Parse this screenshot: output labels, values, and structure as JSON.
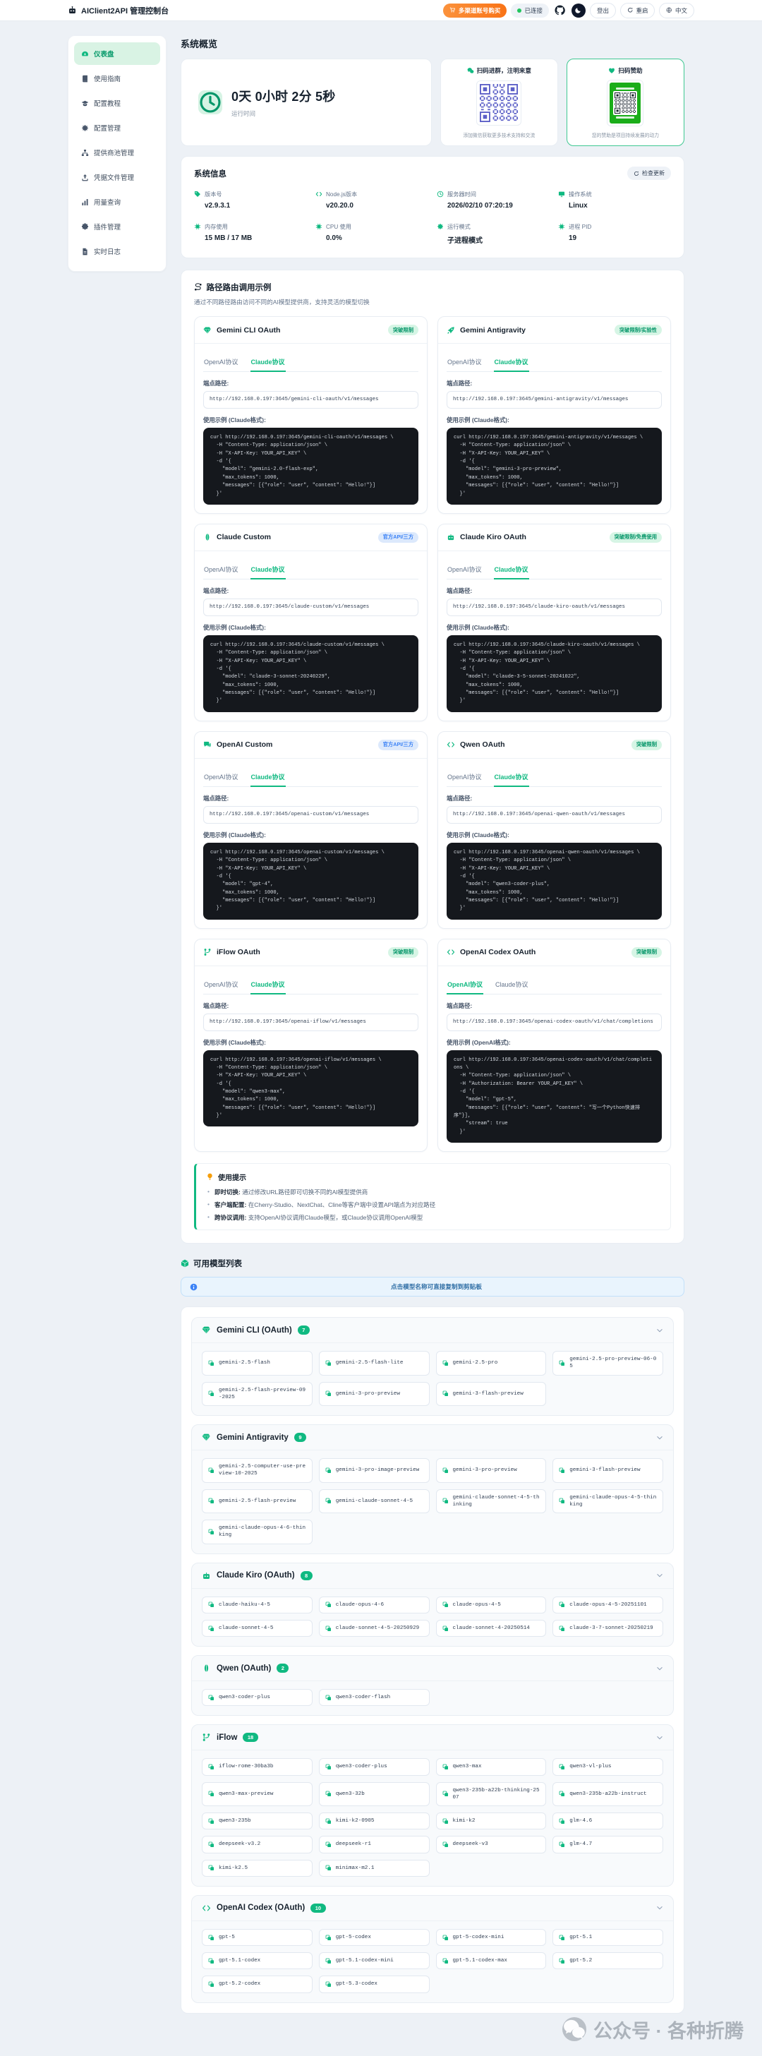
{
  "header": {
    "title": "AIClient2API 管理控制台",
    "logo_icon": "robot-icon",
    "buy_label": "多渠道账号购买",
    "buy_icon": "cart-icon",
    "status_label": "已连接",
    "github_icon": "github-icon",
    "theme_icon": "moon-icon",
    "logout_label": "登出",
    "restart_label": "重启",
    "restart_icon": "refresh-icon",
    "lang_label": "中文",
    "lang_icon": "globe-icon"
  },
  "sidebar": {
    "items": [
      {
        "id": "dashboard",
        "label": "仪表盘",
        "icon": "gauge",
        "active": true
      },
      {
        "id": "guide",
        "label": "使用指南",
        "icon": "book",
        "active": false
      },
      {
        "id": "tutorial",
        "label": "配置教程",
        "icon": "cap",
        "active": false
      },
      {
        "id": "config",
        "label": "配置管理",
        "icon": "gear",
        "active": false
      },
      {
        "id": "provider-pool",
        "label": "提供商池管理",
        "icon": "network",
        "active": false
      },
      {
        "id": "credentials",
        "label": "凭据文件管理",
        "icon": "upload",
        "active": false
      },
      {
        "id": "usage",
        "label": "用量查询",
        "icon": "chart",
        "active": false
      },
      {
        "id": "plugins",
        "label": "插件管理",
        "icon": "puzzle",
        "active": false
      },
      {
        "id": "logs",
        "label": "实时日志",
        "icon": "doc",
        "active": false
      }
    ]
  },
  "overview": {
    "title": "系统概览",
    "uptime": {
      "value": "0天 0小时 2分 5秒",
      "label": "运行时间",
      "icon": "clock-icon"
    },
    "qr_group": {
      "title": "扫码进群，注明来意",
      "icon": "wechat-icon",
      "caption": "添加微信获取更多技术支持和交流",
      "qr_color": "#5b5fc7"
    },
    "qr_sponsor": {
      "title": "扫码赞助",
      "icon": "heart-icon",
      "caption": "您的赞助是项目持续发展的动力",
      "qr_color": "#16202b",
      "frame_color": "#1aad19"
    }
  },
  "system_info": {
    "title": "系统信息",
    "check_update_label": "检查更新",
    "check_update_icon": "refresh-icon",
    "fields": [
      {
        "label": "版本号",
        "icon": "tag",
        "value": "v2.9.3.1"
      },
      {
        "label": "Node.js版本",
        "icon": "code",
        "value": "v20.20.0"
      },
      {
        "label": "服务器时间",
        "icon": "clock",
        "value": "2026/02/10 07:20:19"
      },
      {
        "label": "操作系统",
        "icon": "monitor",
        "value": "Linux"
      },
      {
        "label": "内存使用",
        "icon": "chip",
        "value": "15 MB / 17 MB"
      },
      {
        "label": "CPU 使用",
        "icon": "chip",
        "value": "0.0%"
      },
      {
        "label": "运行模式",
        "icon": "gear",
        "value": "子进程模式"
      },
      {
        "label": "进程 PID",
        "icon": "chip",
        "value": "19"
      }
    ]
  },
  "routes": {
    "title": "路径路由调用示例",
    "title_icon": "route-icon",
    "subtitle": "通过不同路径路由访问不同的AI模型提供商，支持灵活的模型切换",
    "tab_openai": "OpenAI协议",
    "tab_claude": "Claude协议",
    "endpoint_label": "端点路径:",
    "cards": [
      {
        "name": "Gemini CLI OAuth",
        "icon": "gem",
        "badge": "突破限制",
        "badge_type": "green",
        "active_tab": "claude",
        "endpoint": "http://192.168.0.197:3645/gemini-cli-oauth/v1/messages",
        "example_label": "使用示例 (Claude格式):",
        "code": "curl http://192.168.0.197:3645/gemini-cli-oauth/v1/messages \\\n  -H \"Content-Type: application/json\" \\\n  -H \"X-API-Key: YOUR_API_KEY\" \\\n  -d '{\n    \"model\": \"gemini-2.0-flash-exp\",\n    \"max_tokens\": 1000,\n    \"messages\": [{\"role\": \"user\", \"content\": \"Hello!\"}]\n  }'"
      },
      {
        "name": "Gemini Antigravity",
        "icon": "rocket",
        "badge": "突破限制/实验性",
        "badge_type": "green",
        "active_tab": "claude",
        "endpoint": "http://192.168.0.197:3645/gemini-antigravity/v1/messages",
        "example_label": "使用示例 (Claude格式):",
        "code": "curl http://192.168.0.197:3645/gemini-antigravity/v1/messages \\\n  -H \"Content-Type: application/json\" \\\n  -H \"X-API-Key: YOUR_API_KEY\" \\\n  -d '{\n    \"model\": \"gemini-3-pro-preview\",\n    \"max_tokens\": 1000,\n    \"messages\": [{\"role\": \"user\", \"content\": \"Hello!\"}]\n  }'"
      },
      {
        "name": "Claude Custom",
        "icon": "pill",
        "badge": "官方API/三方",
        "badge_type": "blue",
        "active_tab": "claude",
        "endpoint": "http://192.168.0.197:3645/claude-custom/v1/messages",
        "example_label": "使用示例 (Claude格式):",
        "code": "curl http://192.168.0.197:3645/claude-custom/v1/messages \\\n  -H \"Content-Type: application/json\" \\\n  -H \"X-API-Key: YOUR_API_KEY\" \\\n  -d '{\n    \"model\": \"claude-3-sonnet-20240229\",\n    \"max_tokens\": 1000,\n    \"messages\": [{\"role\": \"user\", \"content\": \"Hello!\"}]\n  }'"
      },
      {
        "name": "Claude Kiro OAuth",
        "icon": "bot",
        "badge": "突破限制/免费使用",
        "badge_type": "green",
        "active_tab": "claude",
        "endpoint": "http://192.168.0.197:3645/claude-kiro-oauth/v1/messages",
        "example_label": "使用示例 (Claude格式):",
        "code": "curl http://192.168.0.197:3645/claude-kiro-oauth/v1/messages \\\n  -H \"Content-Type: application/json\" \\\n  -H \"X-API-Key: YOUR_API_KEY\" \\\n  -d '{\n    \"model\": \"claude-3-5-sonnet-20241022\",\n    \"max_tokens\": 1000,\n    \"messages\": [{\"role\": \"user\", \"content\": \"Hello!\"}]\n  }'"
      },
      {
        "name": "OpenAI Custom",
        "icon": "chat",
        "badge": "官方API/三方",
        "badge_type": "blue",
        "active_tab": "claude",
        "endpoint": "http://192.168.0.197:3645/openai-custom/v1/messages",
        "example_label": "使用示例 (Claude格式):",
        "code": "curl http://192.168.0.197:3645/openai-custom/v1/messages \\\n  -H \"Content-Type: application/json\" \\\n  -H \"X-API-Key: YOUR_API_KEY\" \\\n  -d '{\n    \"model\": \"gpt-4\",\n    \"max_tokens\": 1000,\n    \"messages\": [{\"role\": \"user\", \"content\": \"Hello!\"}]\n  }'"
      },
      {
        "name": "Qwen OAuth",
        "icon": "code",
        "badge": "突破限制",
        "badge_type": "green",
        "active_tab": "claude",
        "endpoint": "http://192.168.0.197:3645/openai-qwen-oauth/v1/messages",
        "example_label": "使用示例 (Claude格式):",
        "code": "curl http://192.168.0.197:3645/openai-qwen-oauth/v1/messages \\\n  -H \"Content-Type: application/json\" \\\n  -H \"X-API-Key: YOUR_API_KEY\" \\\n  -d '{\n    \"model\": \"qwen3-coder-plus\",\n    \"max_tokens\": 1000,\n    \"messages\": [{\"role\": \"user\", \"content\": \"Hello!\"}]\n  }'"
      },
      {
        "name": "iFlow OAuth",
        "icon": "branch",
        "badge": "突破限制",
        "badge_type": "green",
        "active_tab": "claude",
        "endpoint": "http://192.168.0.197:3645/openai-iflow/v1/messages",
        "example_label": "使用示例 (Claude格式):",
        "code": "curl http://192.168.0.197:3645/openai-iflow/v1/messages \\\n  -H \"Content-Type: application/json\" \\\n  -H \"X-API-Key: YOUR_API_KEY\" \\\n  -d '{\n    \"model\": \"qwen3-max\",\n    \"max_tokens\": 1000,\n    \"messages\": [{\"role\": \"user\", \"content\": \"Hello!\"}]\n  }'"
      },
      {
        "name": "OpenAI Codex OAuth",
        "icon": "code",
        "badge": "突破限制",
        "badge_type": "green",
        "active_tab": "openai",
        "endpoint": "http://192.168.0.197:3645/openai-codex-oauth/v1/chat/completions",
        "example_label": "使用示例 (OpenAI格式):",
        "code": "curl http://192.168.0.197:3645/openai-codex-oauth/v1/chat/completions \\\n  -H \"Content-Type: application/json\" \\\n  -H \"Authorization: Bearer YOUR_API_KEY\" \\\n  -d '{\n    \"model\": \"gpt-5\",\n    \"messages\": [{\"role\": \"user\", \"content\": \"写一个Python快速排序\"}],\n    \"stream\": true\n  }'"
      }
    ]
  },
  "tips": {
    "title": "使用提示",
    "title_icon": "bulb-icon",
    "items": [
      {
        "label": "即时切换:",
        "text": "通过修改URL路径即可切换不同的AI模型提供商"
      },
      {
        "label": "客户端配置:",
        "text": "在Cherry-Studio、NextChat、Cline等客户端中设置API端点为对应路径"
      },
      {
        "label": "跨协议调用:",
        "text": "支持OpenAI协议调用Claude模型，或Claude协议调用OpenAI模型"
      }
    ]
  },
  "models": {
    "title": "可用模型列表",
    "title_icon": "box-icon",
    "banner": "点击模型名称可直接复制到剪贴板",
    "banner_icon": "info-icon",
    "chip_icon": "copy-icon",
    "groups": [
      {
        "name": "Gemini CLI (OAuth)",
        "icon": "gem",
        "count": 7,
        "models": [
          "gemini-2.5-flash",
          "gemini-2.5-flash-lite",
          "gemini-2.5-pro",
          "gemini-2.5-pro-preview-06-05",
          "gemini-2.5-flash-preview-09-2025",
          "gemini-3-pro-preview",
          "gemini-3-flash-preview"
        ]
      },
      {
        "name": "Gemini Antigravity",
        "icon": "gem",
        "count": 9,
        "models": [
          "gemini-2.5-computer-use-preview-10-2025",
          "gemini-3-pro-image-preview",
          "gemini-3-pro-preview",
          "gemini-3-flash-preview",
          "gemini-2.5-flash-preview",
          "gemini-claude-sonnet-4-5",
          "gemini-claude-sonnet-4-5-thinking",
          "gemini-claude-opus-4-5-thinking",
          "gemini-claude-opus-4-6-thinking"
        ]
      },
      {
        "name": "Claude Kiro (OAuth)",
        "icon": "bot",
        "count": 8,
        "models": [
          "claude-haiku-4-5",
          "claude-opus-4-6",
          "claude-opus-4-5",
          "claude-opus-4-5-20251101",
          "claude-sonnet-4-5",
          "claude-sonnet-4-5-20250929",
          "claude-sonnet-4-20250514",
          "claude-3-7-sonnet-20250219"
        ]
      },
      {
        "name": "Qwen (OAuth)",
        "icon": "pill",
        "count": 2,
        "models": [
          "qwen3-coder-plus",
          "qwen3-coder-flash"
        ]
      },
      {
        "name": "iFlow",
        "icon": "branch",
        "count": 18,
        "models": [
          "iflow-rome-30ba3b",
          "qwen3-coder-plus",
          "qwen3-max",
          "qwen3-vl-plus",
          "qwen3-max-preview",
          "qwen3-32b",
          "qwen3-235b-a22b-thinking-2507",
          "qwen3-235b-a22b-instruct",
          "qwen3-235b",
          "kimi-k2-0905",
          "kimi-k2",
          "glm-4.6",
          "deepseek-v3.2",
          "deepseek-r1",
          "deepseek-v3",
          "glm-4.7",
          "kimi-k2.5",
          "minimax-m2.1"
        ]
      },
      {
        "name": "OpenAI Codex (OAuth)",
        "icon": "code",
        "count": 10,
        "models": [
          "gpt-5",
          "gpt-5-codex",
          "gpt-5-codex-mini",
          "gpt-5.1",
          "gpt-5.1-codex",
          "gpt-5.1-codex-mini",
          "gpt-5.1-codex-max",
          "gpt-5.2",
          "gpt-5.2-codex",
          "gpt-5.3-codex"
        ]
      }
    ]
  },
  "watermark": {
    "text": "公众号 · 各种折腾",
    "icon": "wechat-icon"
  }
}
